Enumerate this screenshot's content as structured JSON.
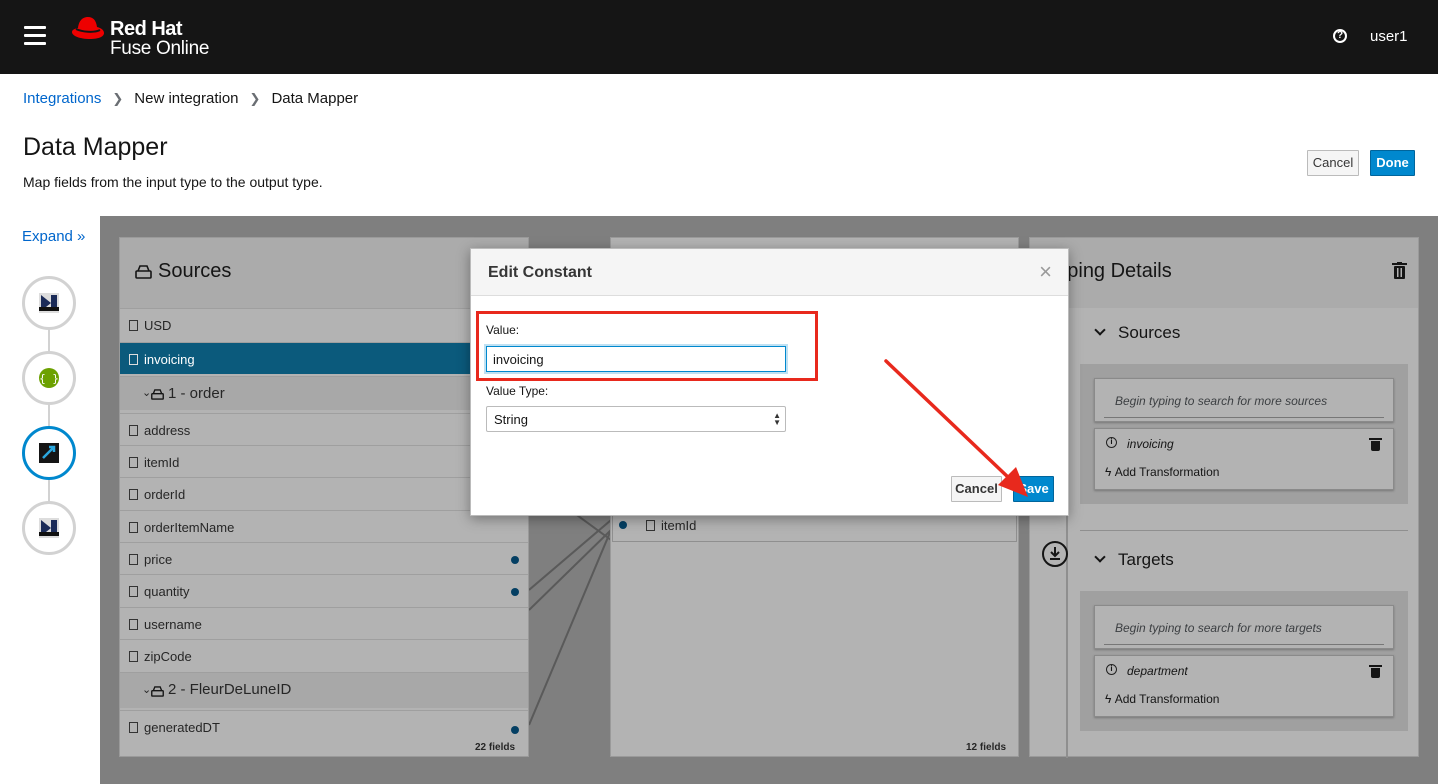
{
  "header": {
    "brand_line1": "Red Hat",
    "brand_line2": "Fuse Online",
    "help_glyph": "?",
    "user": "user1"
  },
  "breadcrumb": [
    "Integrations",
    "New integration",
    "Data Mapper"
  ],
  "page": {
    "title": "Data Mapper",
    "subtitle": "Map fields from the input type to the output type.",
    "cancel_label": "Cancel",
    "done_label": "Done"
  },
  "rail": {
    "expand_label": "Expand"
  },
  "sources_panel": {
    "title": "Sources",
    "rows": [
      "USD",
      "invoicing"
    ],
    "group1": "1 - order",
    "group1_fields": [
      "address",
      "itemId",
      "orderId",
      "orderItemName",
      "price",
      "quantity",
      "username",
      "zipCode"
    ],
    "group2": "2 - FleurDeLuneID",
    "group2_fields": [
      "generatedDT"
    ],
    "footer": "22 fields"
  },
  "target_panel": {
    "visible_field": "itemId",
    "footer": "12 fields"
  },
  "details_panel": {
    "title_visible": "apping Details",
    "sources_label": "Sources",
    "sources_search_placeholder": "Begin typing to search for more sources",
    "source_name": "invoicing",
    "add_transformation": "Add Transformation",
    "targets_label": "Targets",
    "targets_search_placeholder": "Begin typing to search for more targets",
    "target_name": "department"
  },
  "modal": {
    "title": "Edit Constant",
    "close_glyph": "×",
    "value_label": "Value:",
    "value": "invoicing",
    "value_type_label": "Value Type:",
    "value_type": "String",
    "cancel_label": "Cancel",
    "save_label": "Save"
  },
  "colors": {
    "accent": "#0088ce",
    "header_bg": "#151515",
    "annotation": "#e8291d",
    "selected_row": "#0b5a7c",
    "red_hat": "#ee0000"
  }
}
